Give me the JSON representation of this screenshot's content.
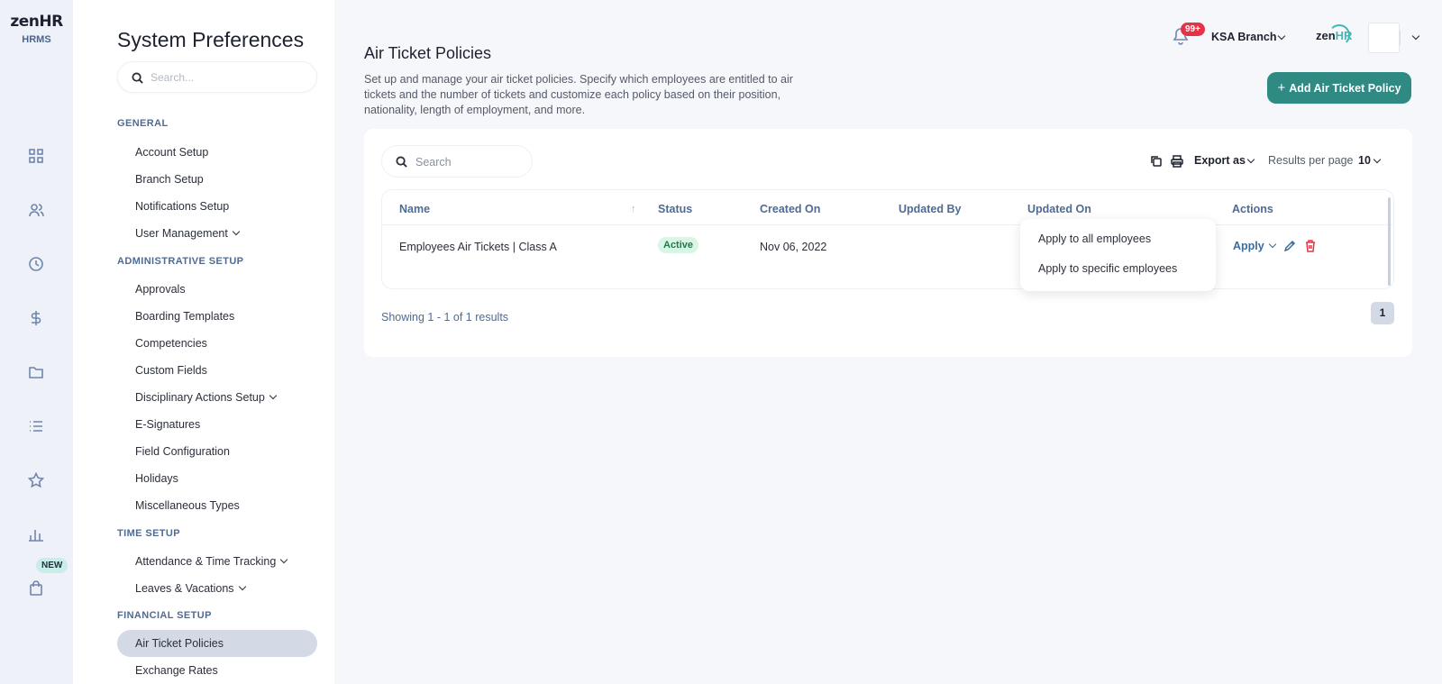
{
  "app": {
    "logo_word": "zen",
    "logo_hr": "HR",
    "logo_sub": "HRMS",
    "new_badge": "NEW"
  },
  "rail_icons": [
    "dashboard-icon",
    "people-icon",
    "clock-icon",
    "dollar-icon",
    "folder-icon",
    "list-icon",
    "star-icon",
    "bar-chart-icon",
    "bag-icon"
  ],
  "sidebar": {
    "title": "System Preferences",
    "search_placeholder": "Search...",
    "sections": {
      "general": "GENERAL",
      "administrative": "ADMINISTRATIVE SETUP",
      "time": "TIME SETUP",
      "financial": "FINANCIAL SETUP"
    },
    "items": {
      "account_setup": "Account Setup",
      "branch_setup": "Branch Setup",
      "notifications_setup": "Notifications Setup",
      "user_management": "User Management",
      "approvals": "Approvals",
      "boarding_templates": "Boarding Templates",
      "competencies": "Competencies",
      "custom_fields": "Custom Fields",
      "disciplinary_actions_setup": "Disciplinary Actions Setup",
      "e_signatures": "E-Signatures",
      "field_configuration": "Field Configuration",
      "holidays": "Holidays",
      "miscellaneous_types": "Miscellaneous Types",
      "attendance_time_tracking": "Attendance & Time Tracking",
      "leaves_vacations": "Leaves & Vacations",
      "air_ticket_policies": "Air Ticket Policies",
      "exchange_rates": "Exchange Rates"
    }
  },
  "header": {
    "notification_count": "99+",
    "branch": "KSA Branch",
    "brand_word": "zen",
    "brand_hr": "HR"
  },
  "main": {
    "title": "Air Ticket Policies",
    "description": "Set up and manage your air ticket policies. Specify which employees are entitled to air tickets and the number of tickets and customize each policy based on their position, nationality, length of employment, and more.",
    "add_button": "Add Air Ticket Policy",
    "add_button_plus": "+"
  },
  "table_toolbar": {
    "search_placeholder": "Search",
    "export_label": "Export as",
    "results_per_page_label": "Results per page",
    "results_per_page_value": "10"
  },
  "table": {
    "columns": [
      "Name",
      "Status",
      "Created On",
      "Updated By",
      "Updated On",
      "Actions"
    ],
    "sort_indicator": "↑",
    "rows": [
      {
        "name": "Employees Air Tickets | Class A",
        "status": "Active",
        "created_on": "Nov 06, 2022",
        "updated_by": "",
        "updated_on": "",
        "action_label": "Apply"
      }
    ]
  },
  "apply_dropdown": {
    "options": [
      "Apply to all employees",
      "Apply to specific employees"
    ]
  },
  "footer": {
    "showing": "Showing 1 - 1 of 1 results",
    "page": "1"
  },
  "colors": {
    "accent": "#2f8a84",
    "nav_label": "#4f6b93",
    "danger": "#e53345",
    "active_badge_bg": "#d9f5e6",
    "selected_nav_bg": "#d3dae6"
  }
}
